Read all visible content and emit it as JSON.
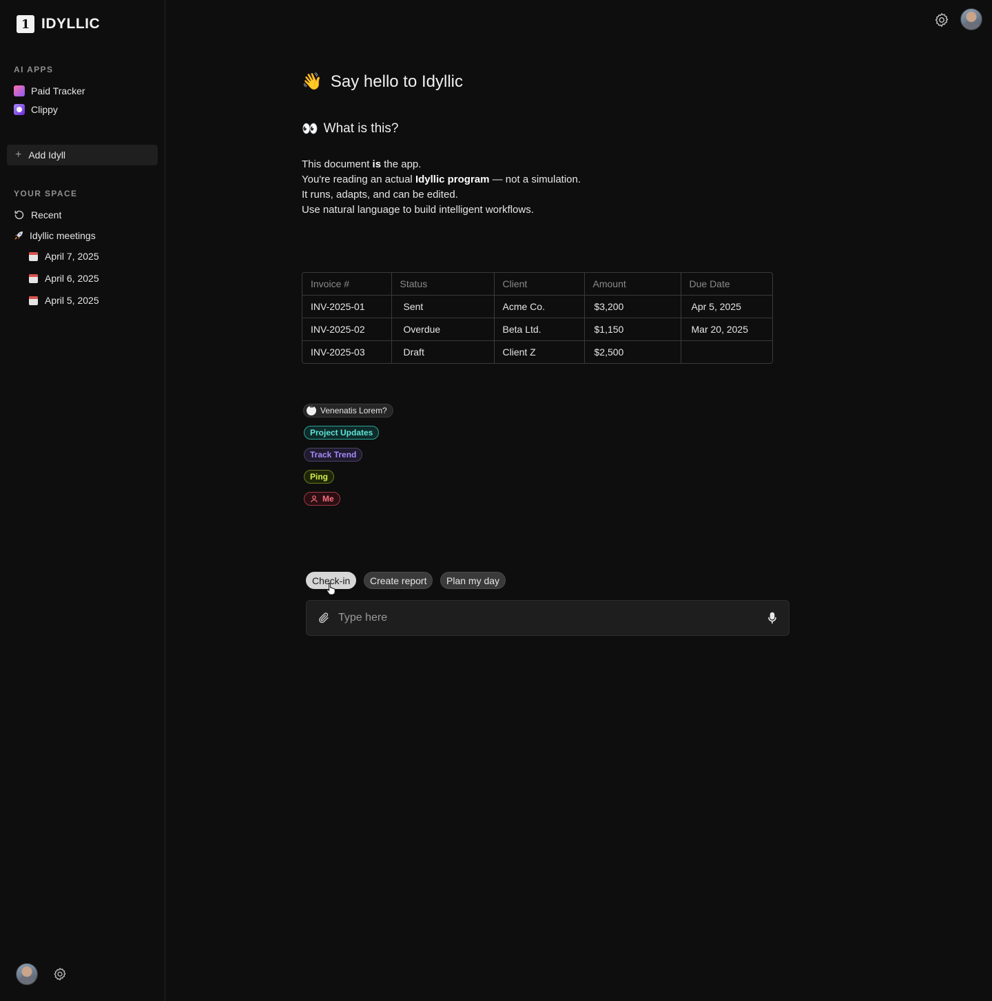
{
  "brand": {
    "logo_mark": "1",
    "name": "IDYLLIC"
  },
  "sidebar": {
    "ai_apps_label": "AI APPS",
    "apps": [
      {
        "label": "Paid Tracker",
        "icon": "paid-tracker-icon"
      },
      {
        "label": "Clippy",
        "icon": "clippy-icon"
      }
    ],
    "add_label": "Add Idyll",
    "your_space_label": "YOUR SPACE",
    "recent_label": "Recent",
    "meetings_label": "Idyllic meetings",
    "meetings": [
      {
        "label": "April 7, 2025"
      },
      {
        "label": "April 6, 2025"
      },
      {
        "label": "April 5, 2025"
      }
    ]
  },
  "main": {
    "heading_emoji": "👋",
    "heading": "Say hello to Idyllic",
    "subheading_emoji": "👀",
    "subheading": "What is this?",
    "para": {
      "l1_pre": "This document ",
      "l1_bold": "is",
      "l1_post": " the app.",
      "l2_pre": "You're reading an actual ",
      "l2_bold": "Idyllic program",
      "l2_post": " — not a simulation.",
      "l3": "It runs, adapts, and can be edited.",
      "l4": "Use natural language to build intelligent workflows."
    },
    "table": {
      "headers": [
        "Invoice #",
        "Status",
        "Client",
        "Amount",
        "Due Date"
      ],
      "rows": [
        [
          "INV-2025-01",
          "Sent",
          "Acme Co.",
          "$3,200",
          "Apr 5, 2025"
        ],
        [
          "INV-2025-02",
          "Overdue",
          "Beta Ltd.",
          "$1,150",
          "Mar 20, 2025"
        ],
        [
          "INV-2025-03",
          "Draft",
          "Client Z",
          "$2,500",
          ""
        ]
      ]
    },
    "tags": [
      {
        "label": "Venenatis Lorem?"
      },
      {
        "label": "Project Updates"
      },
      {
        "label": "Track Trend"
      },
      {
        "label": "Ping"
      },
      {
        "label": "Me"
      }
    ],
    "chips": [
      {
        "label": "Check-in",
        "active": true
      },
      {
        "label": "Create report"
      },
      {
        "label": "Plan my day"
      }
    ],
    "input": {
      "placeholder": "Type here",
      "value": ""
    }
  }
}
